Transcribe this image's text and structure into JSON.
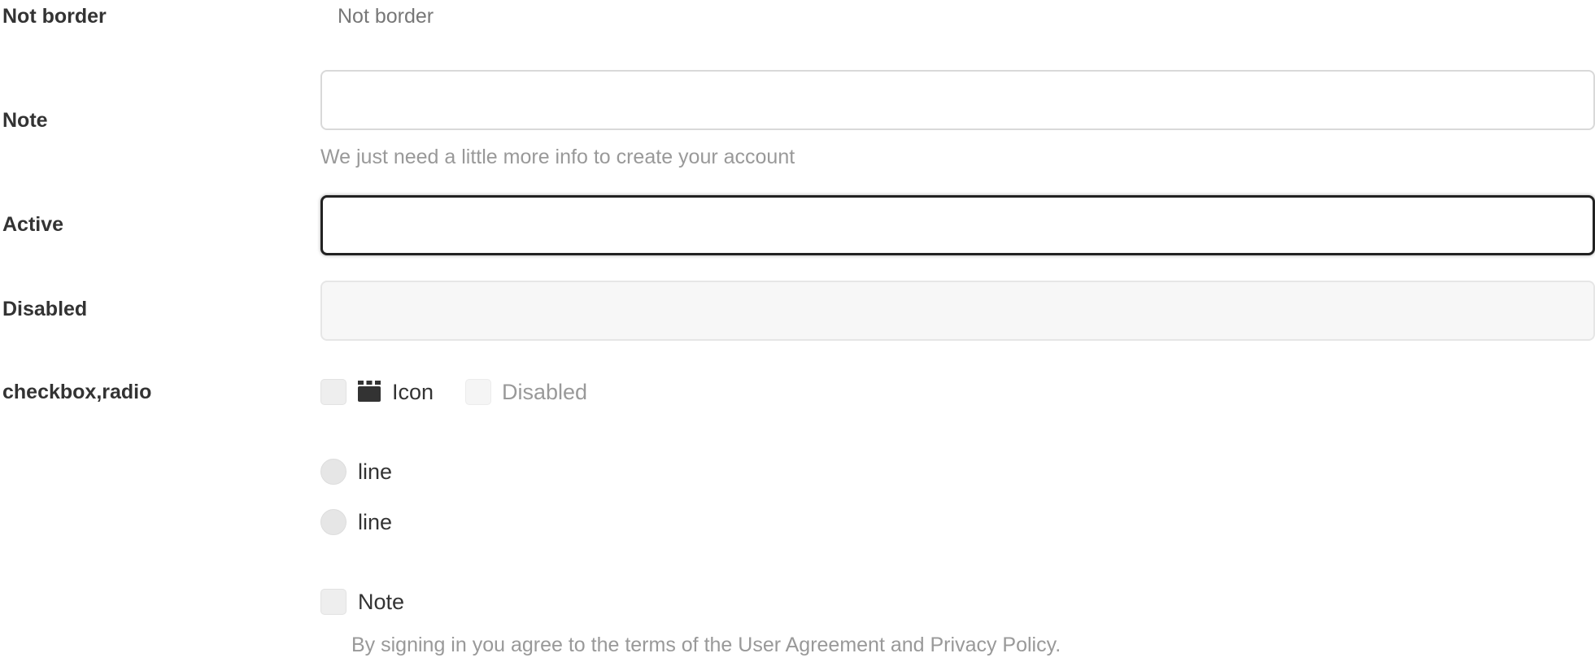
{
  "rows": {
    "not_border": {
      "label": "Not border",
      "value": "Not border"
    },
    "note": {
      "label": "Note",
      "value": "",
      "help": "We just need a little more info to create your account"
    },
    "active": {
      "label": "Active",
      "value": ""
    },
    "disabled": {
      "label": "Disabled",
      "value": ""
    },
    "checkbox_radio": {
      "label": "checkbox,radio",
      "checkbox_icon_label": "Icon",
      "checkbox_disabled_label": "Disabled",
      "radio_1_label": "line",
      "radio_2_label": "line",
      "note_checkbox_label": "Note",
      "terms_text": "By signing in you agree to the terms of the User Agreement and Privacy Policy."
    }
  },
  "icons": {
    "checkbox_icon": "calendar-icon"
  },
  "colors": {
    "text": "#333333",
    "muted": "#999999",
    "border": "#d9d9d9",
    "active_border": "#222222",
    "disabled_bg": "#f7f7f7"
  }
}
